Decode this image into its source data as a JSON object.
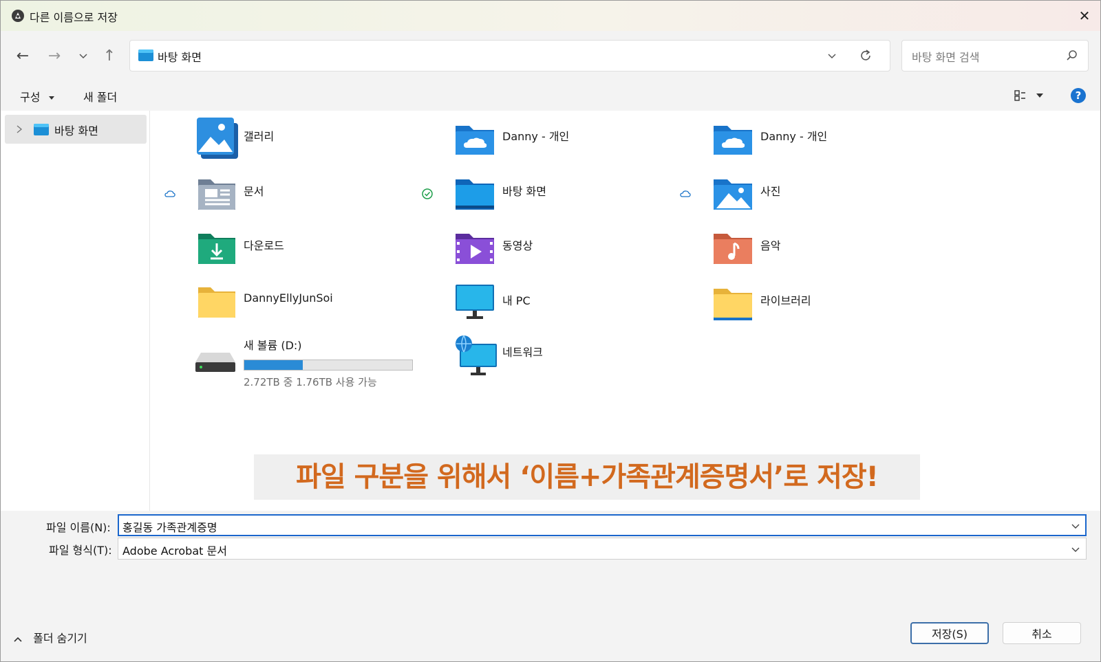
{
  "window": {
    "title": "다른 이름으로 저장",
    "close_glyph": "✕"
  },
  "nav": {
    "back_glyph": "←",
    "forward_glyph": "→",
    "recent_glyph": "⌄",
    "up_glyph": "↑",
    "address": "바탕 화면",
    "search_placeholder": "바탕 화면 검색"
  },
  "command_bar": {
    "organize": "구성",
    "new_folder": "새 폴더",
    "help": "?"
  },
  "sidebar": {
    "items": [
      {
        "label": "바탕 화면",
        "icon": "desktop-folder-icon"
      }
    ]
  },
  "content": {
    "items": [
      {
        "label": "갤러리",
        "icon": "gallery-icon"
      },
      {
        "label": "Danny - 개인",
        "icon": "onedrive-folder-icon"
      },
      {
        "label": "Danny - 개인",
        "icon": "onedrive-folder-icon"
      },
      {
        "label": "문서",
        "icon": "documents-folder-icon",
        "sync": "cloud"
      },
      {
        "label": "바탕 화면",
        "icon": "desktop-folder-icon",
        "sync": "synced-check"
      },
      {
        "label": "사진",
        "icon": "pictures-folder-icon",
        "sync": "cloud"
      },
      {
        "label": "다운로드",
        "icon": "downloads-folder-icon"
      },
      {
        "label": "동영상",
        "icon": "videos-folder-icon"
      },
      {
        "label": "음악",
        "icon": "music-folder-icon"
      },
      {
        "label": "DannyEllyJunSoi",
        "icon": "folder-icon"
      },
      {
        "label": "내 PC",
        "icon": "this-pc-icon"
      },
      {
        "label": "라이브러리",
        "icon": "libraries-icon"
      },
      {
        "label": "새 볼륨 (D:)",
        "icon": "drive-icon",
        "subtitle": "2.72TB 중 1.76TB 사용 가능",
        "usage_fraction": 0.35
      },
      {
        "label": "네트워크",
        "icon": "network-icon"
      }
    ]
  },
  "overlay": {
    "caption": "파일 구분을 위해서 ‘이름+가족관계증명서’로 저장!",
    "color": "#d2691e"
  },
  "form": {
    "filename_label": "파일 이름(N):",
    "filename_value": "홍길동 가족관계증명",
    "filetype_label": "파일 형식(T):",
    "filetype_value": "Adobe Acrobat 문서",
    "hide_folders": "폴더 숨기기",
    "save": "저장(S)",
    "cancel": "취소"
  },
  "colors": {
    "accent": "#1a66cc",
    "titlebar": "#eef3e3"
  }
}
